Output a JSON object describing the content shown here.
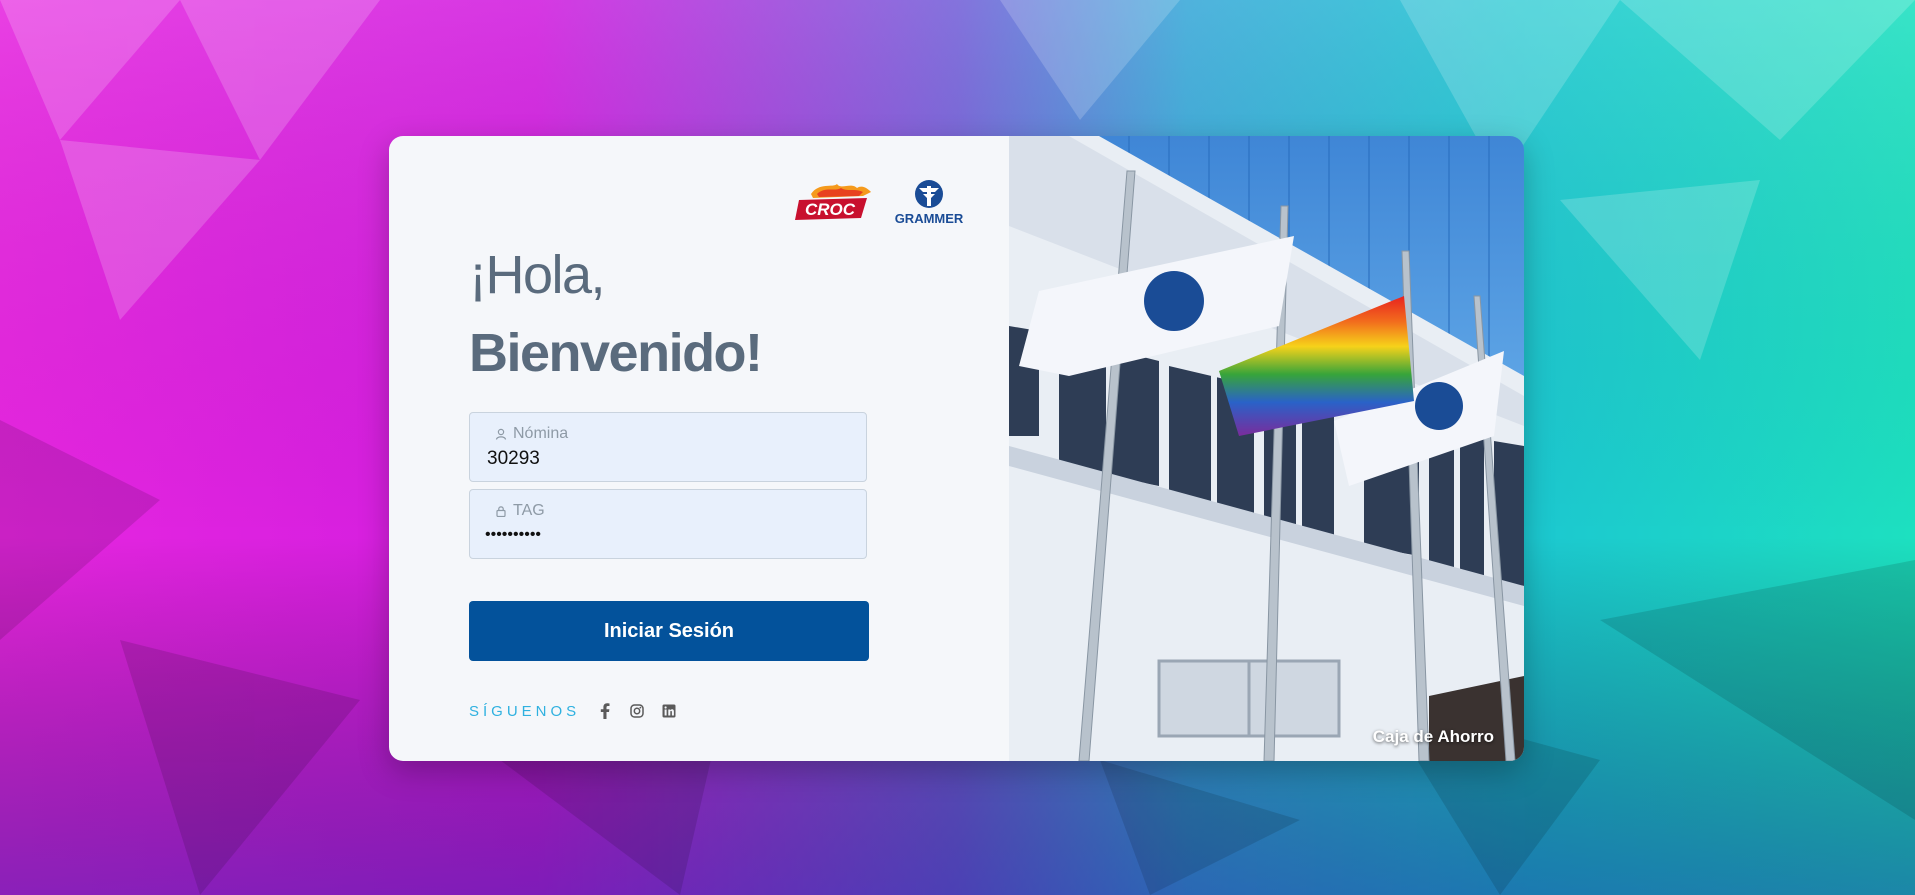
{
  "brand_logos": {
    "croc": "CROC",
    "grammer": "GRAMMER"
  },
  "greeting": {
    "line1": "¡Hola,",
    "line2": "Bienvenido!"
  },
  "form": {
    "nomina_label": "Nómina",
    "nomina_value": "30293",
    "tag_label": "TAG",
    "tag_value": "••••••••••",
    "submit_label": "Iniciar Sesión"
  },
  "social": {
    "label": "SÍGUENOS",
    "icons": [
      "facebook-icon",
      "instagram-icon",
      "linkedin-icon"
    ]
  },
  "photo": {
    "caption": "Caja de Ahorro"
  },
  "colors": {
    "primary_button": "#03529b",
    "heading": "#5a6b7d",
    "accent": "#2fb1e0",
    "field_bg": "#e8f0fc"
  }
}
